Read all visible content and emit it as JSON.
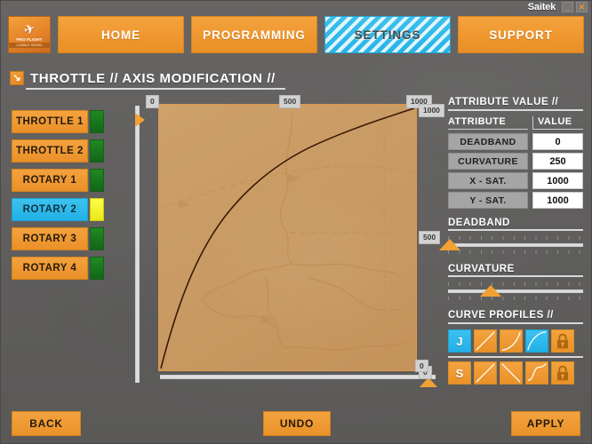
{
  "window": {
    "brand": "Saitek",
    "minimize_label": "_",
    "close_label": "✕"
  },
  "logo": {
    "jet_icon": "✈",
    "line1": "PRO FLIGHT",
    "line2": "COMBAT SERIES"
  },
  "nav": {
    "tabs": [
      {
        "label": "HOME",
        "active": false
      },
      {
        "label": "PROGRAMMING",
        "active": false
      },
      {
        "label": "SETTINGS",
        "active": true
      },
      {
        "label": "SUPPORT",
        "active": false
      }
    ]
  },
  "heading": {
    "arrow_icon": "↘",
    "text": "THROTTLE //  AXIS MODIFICATION //"
  },
  "sidebar": {
    "items": [
      {
        "label": "THROTTLE 1",
        "selected": false
      },
      {
        "label": "THROTTLE 2",
        "selected": false
      },
      {
        "label": "ROTARY 1",
        "selected": false
      },
      {
        "label": "ROTARY 2",
        "selected": true
      },
      {
        "label": "ROTARY 3",
        "selected": false
      },
      {
        "label": "ROTARY 4",
        "selected": false
      }
    ]
  },
  "graph": {
    "top_labels": [
      "0",
      "500",
      "1000"
    ],
    "right_labels": [
      "1000",
      "500",
      "0"
    ],
    "vertical_slider_value": "0",
    "horizontal_slider_value": "0",
    "fill_color": "#c99a63",
    "curve_color": "#3a1a06"
  },
  "attribute_panel": {
    "title": "ATTRIBUTE VALUE //",
    "col_attribute": "ATTRIBUTE",
    "col_value": "VALUE",
    "rows": [
      {
        "attribute": "DEADBAND",
        "value": "0"
      },
      {
        "attribute": "CURVATURE",
        "value": "250"
      },
      {
        "attribute": "X - SAT.",
        "value": "1000"
      },
      {
        "attribute": "Y - SAT.",
        "value": "1000"
      }
    ]
  },
  "sliders": [
    {
      "label": "DEADBAND",
      "percent": 2
    },
    {
      "label": "CURVATURE",
      "percent": 32
    }
  ],
  "curve_profiles": {
    "title": "CURVE PROFILES //",
    "rows": [
      {
        "buttons": [
          {
            "name": "profile-j",
            "glyph": "J",
            "shape": "text",
            "selected": true
          },
          {
            "name": "profile-linear",
            "glyph": "",
            "shape": "linear",
            "selected": false
          },
          {
            "name": "profile-concave-up",
            "glyph": "",
            "shape": "concave",
            "selected": false
          },
          {
            "name": "profile-convex",
            "glyph": "",
            "shape": "convex",
            "selected": true
          },
          {
            "name": "profile-lock-row1",
            "glyph": "ὑ2",
            "shape": "lock",
            "selected": false
          }
        ]
      },
      {
        "buttons": [
          {
            "name": "profile-s",
            "glyph": "S",
            "shape": "text",
            "selected": false
          },
          {
            "name": "profile-linear-up",
            "glyph": "",
            "shape": "linear",
            "selected": false
          },
          {
            "name": "profile-linear-down",
            "glyph": "",
            "shape": "inverse",
            "selected": false
          },
          {
            "name": "profile-s-curve",
            "glyph": "",
            "shape": "scurve",
            "selected": false
          },
          {
            "name": "profile-lock-row2",
            "glyph": "ὑ2",
            "shape": "lock",
            "selected": false
          }
        ]
      }
    ]
  },
  "footer": {
    "back": "BACK",
    "undo": "UNDO",
    "apply": "APPLY"
  },
  "colors": {
    "orange": "#ef9830",
    "cyan": "#27b4e8",
    "green_led": "#1f8a1f",
    "yellow_led": "#e9e914",
    "panel_gray": "#605f5e"
  }
}
